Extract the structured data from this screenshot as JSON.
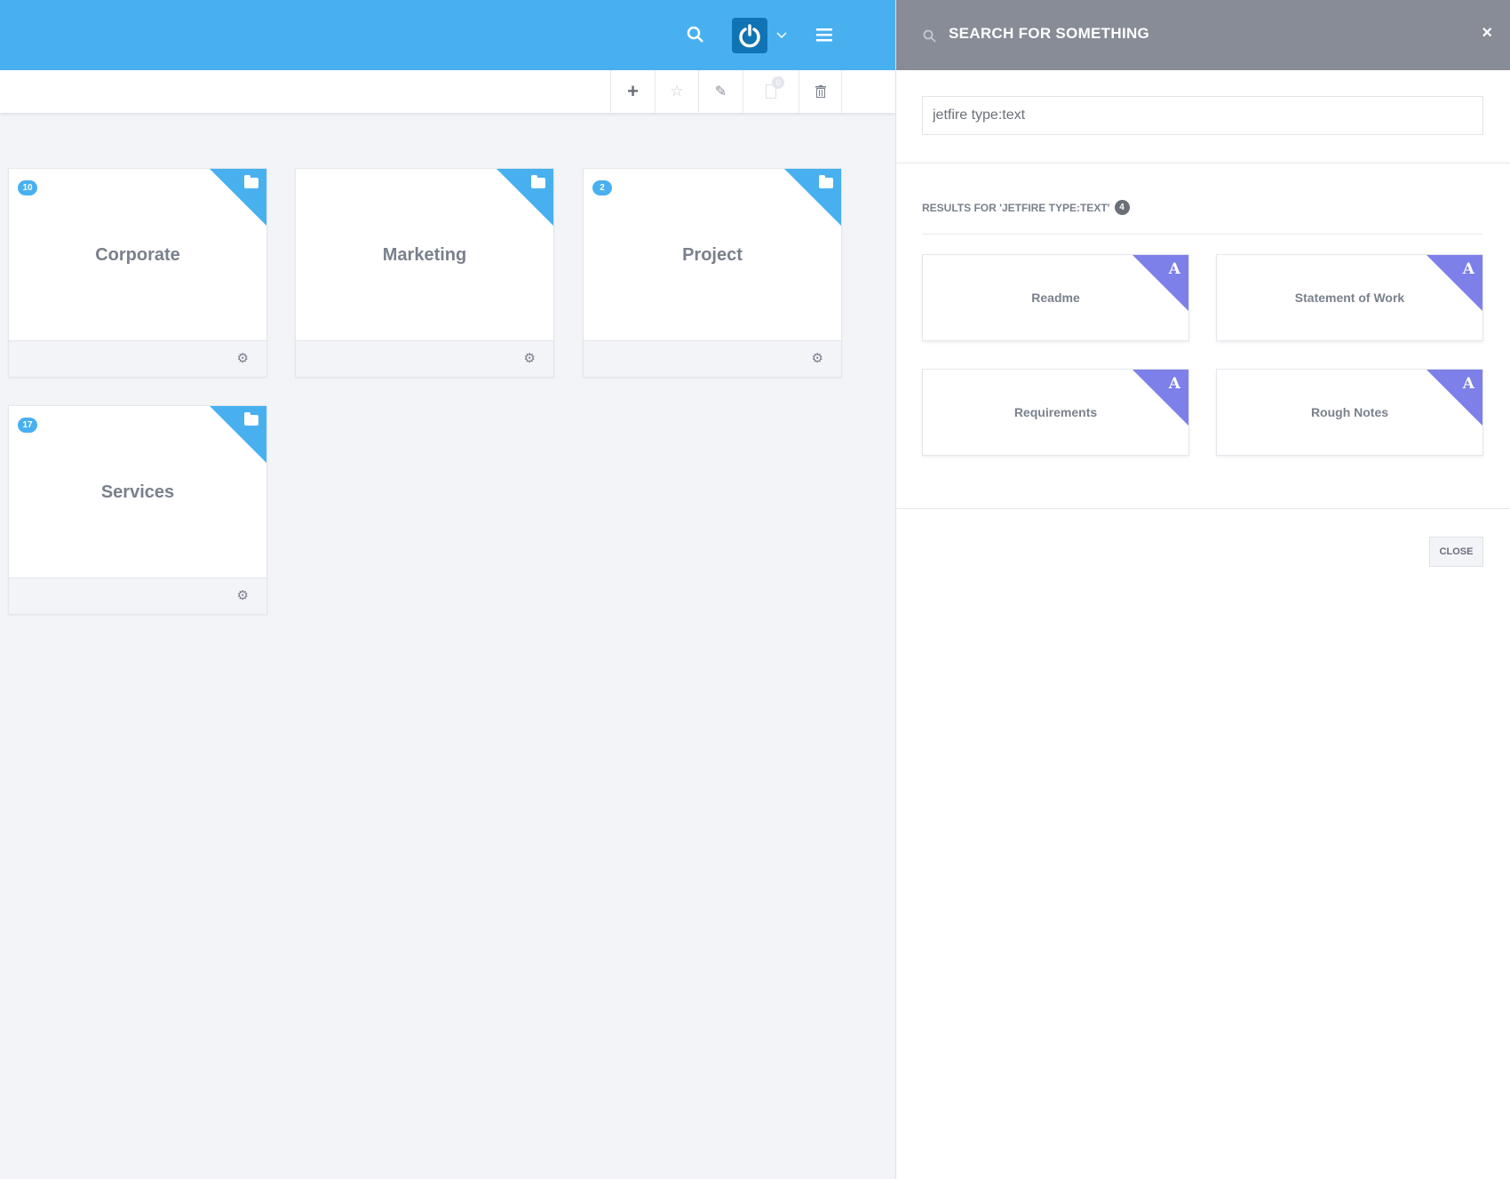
{
  "header": {
    "search_icon": "search-icon",
    "logo_icon": "power-icon",
    "menu_icon": "hamburger-icon",
    "accent": "#48b0ef"
  },
  "toolbar": {
    "items": [
      "plus-icon",
      "star-icon",
      "edit-icon",
      "clipboard-icon",
      "trash-icon"
    ],
    "clipboard_count": "0"
  },
  "folders": [
    {
      "name": "Corporate",
      "count": "10"
    },
    {
      "name": "Marketing",
      "count": ""
    },
    {
      "name": "Project",
      "count": "2"
    },
    {
      "name": "Services",
      "count": "17"
    }
  ],
  "search": {
    "title": "SEARCH FOR SOMETHING",
    "query": "jetfire type:text",
    "results_heading": "RESULTS FOR 'JETFIRE TYPE:TEXT'",
    "results_count": "4",
    "close_label": "CLOSE",
    "close_x": "×",
    "type_glyph": "A",
    "results": [
      "Readme",
      "Statement of Work",
      "Requirements",
      "Rough Notes"
    ]
  }
}
